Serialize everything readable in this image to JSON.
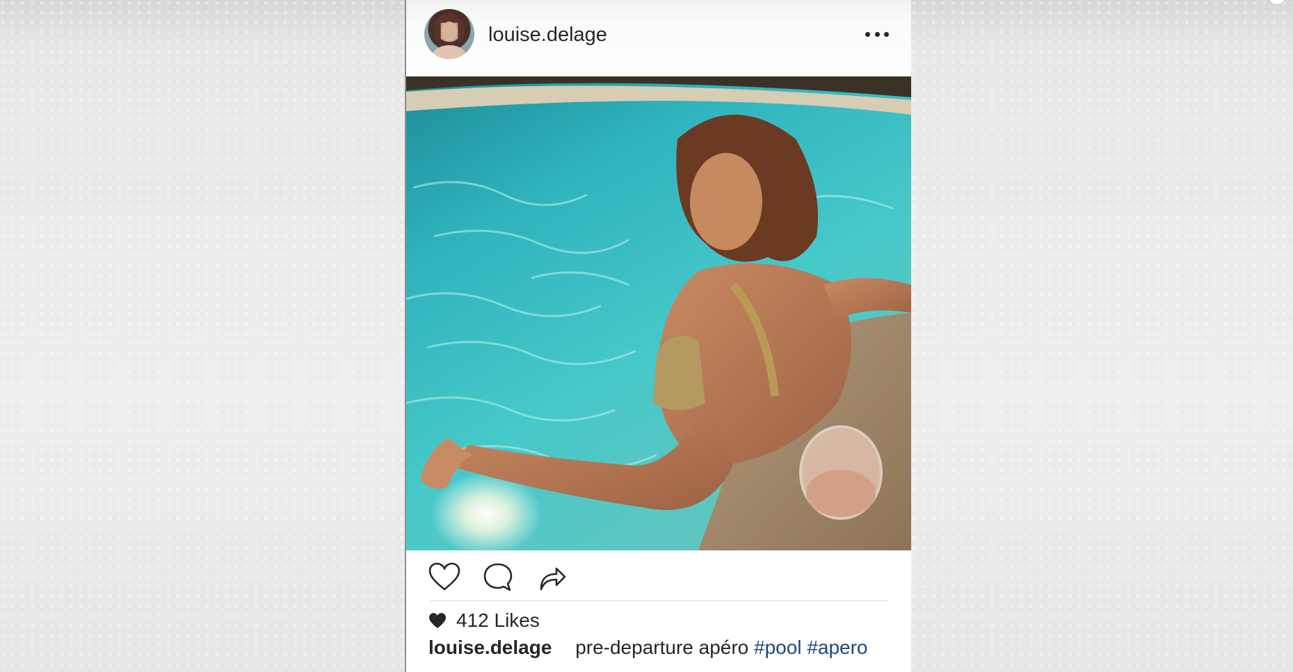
{
  "post": {
    "username": "louise.delage",
    "more_icon": "more-horizontal-icon",
    "actions": {
      "like_icon": "heart-outline-icon",
      "comment_icon": "comment-bubble-icon",
      "share_icon": "share-arrow-icon"
    },
    "likes": {
      "icon": "heart-filled-icon",
      "text": "412 Likes"
    },
    "caption": {
      "username": "louise.delage",
      "text": "pre-departure apéro",
      "hashtags": [
        "#pool",
        "#apero"
      ]
    }
  },
  "colors": {
    "text": "#262626",
    "hashtag": "#1e4a7a",
    "pool_water": "#3fc3c6",
    "divider": "#dbdbdb"
  }
}
